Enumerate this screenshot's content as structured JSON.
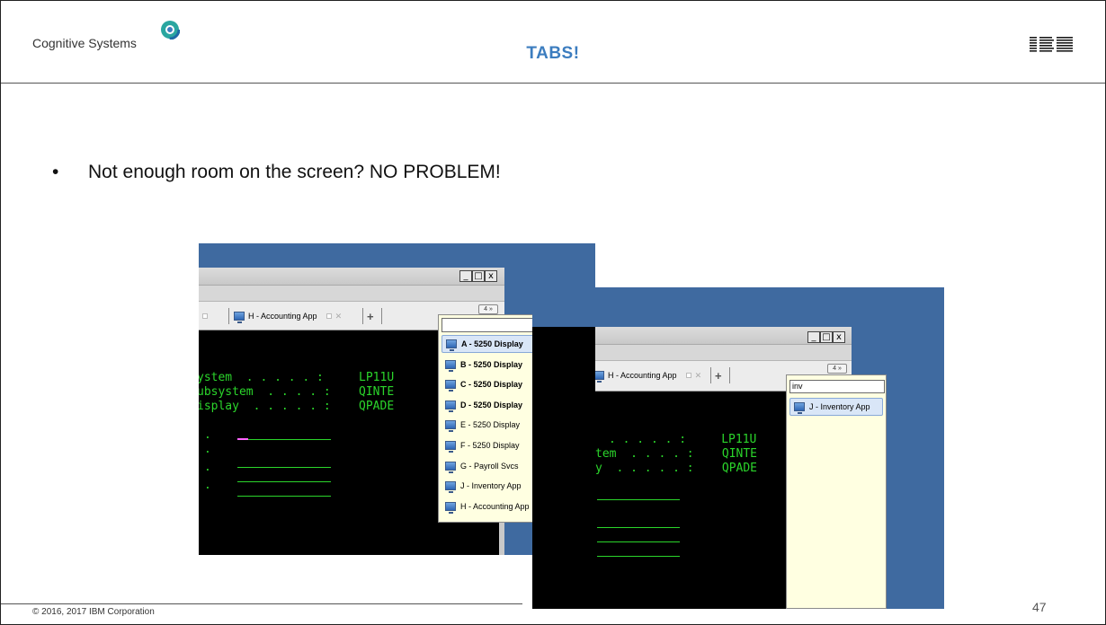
{
  "header": {
    "brand": "Cognitive Systems",
    "title": "TABS!",
    "logo": "IBM"
  },
  "bullet": {
    "symbol": "•",
    "text": "Not enough room on the screen? NO PROBLEM!"
  },
  "footer": {
    "copyright": "© 2016, 2017 IBM Corporation",
    "page_number": "47"
  },
  "shot1": {
    "window_buttons": [
      "_",
      "□",
      "x"
    ],
    "active_tab": "H - Accounting App",
    "overflow_label": "4 »",
    "terminal_lines": [
      "ystem  . . . . . :     LP11U",
      "ubsystem  . . . . :    QINTE",
      "isplay  . . . . . :    QPADE"
    ],
    "terminal_dots": [
      ".",
      ".",
      ".",
      "."
    ],
    "search_value": "",
    "items": [
      {
        "label": "A - 5250 Display",
        "bold": true,
        "selected": true
      },
      {
        "label": "B - 5250 Display",
        "bold": true,
        "selected": false
      },
      {
        "label": "C - 5250 Display",
        "bold": true,
        "selected": false
      },
      {
        "label": "D - 5250 Display",
        "bold": true,
        "selected": false
      },
      {
        "label": "E - 5250 Display",
        "bold": false,
        "selected": false
      },
      {
        "label": "F - 5250 Display",
        "bold": false,
        "selected": false
      },
      {
        "label": "G - Payroll Svcs",
        "bold": false,
        "selected": false
      },
      {
        "label": "J - Inventory App",
        "bold": false,
        "selected": false
      },
      {
        "label": "H - Accounting App",
        "bold": false,
        "selected": false
      }
    ]
  },
  "shot2": {
    "window_buttons": [
      "_",
      "□",
      "x"
    ],
    "active_tab": "H - Accounting App",
    "overflow_label": "4 »",
    "terminal_lines": [
      ". . . . . :     LP11U",
      "tem  . . . . :    QINTE",
      "y  . . . . . :    QPADE"
    ],
    "search_value": "inv",
    "items": [
      {
        "label": "J - Inventory App",
        "bold": false,
        "selected": true
      }
    ]
  },
  "colors": {
    "title": "#3c7dbf",
    "terminal_green": "#2bd52b",
    "desktop_blue": "#3f6aa0",
    "popup_bg": "#ffffe1"
  },
  "icons": [
    "monitor-icon",
    "ibm-logo",
    "cognitive-systems-logo",
    "plus-icon",
    "chevron-overflow-icon"
  ]
}
